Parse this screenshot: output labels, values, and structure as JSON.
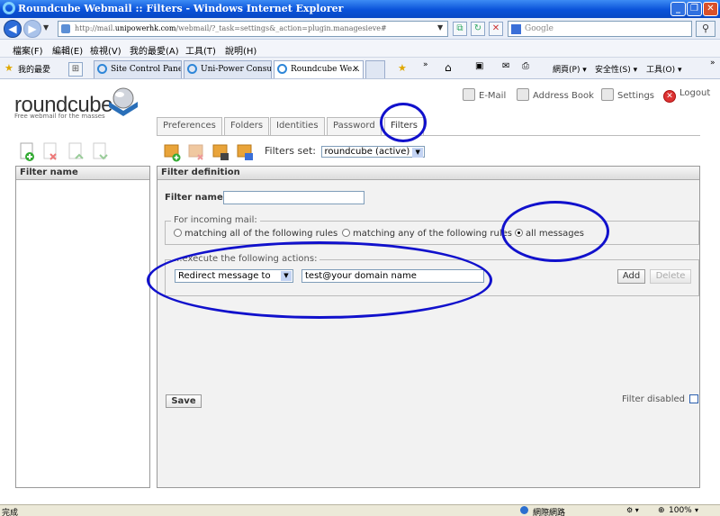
{
  "window": {
    "title": "Roundcube Webmail :: Filters - Windows Internet Explorer"
  },
  "addressbar": {
    "url_prefix": "http://mail.",
    "url_host": "unipowerhk.com",
    "url_rest": "/webmail/?_task=settings&_action=plugin.managesieve#",
    "search_placeholder": "Google"
  },
  "menubar": [
    "檔案(F)",
    "編輯(E)",
    "檢視(V)",
    "我的最愛(A)",
    "工具(T)",
    "說明(H)"
  ],
  "favorites": {
    "label": "我的最愛",
    "tabs": [
      "Site Control Panel",
      "Uni-Power Consult...",
      "Roundcube We..."
    ],
    "commands": [
      "網頁(P) ▾",
      "安全性(S) ▾",
      "工具(O) ▾"
    ]
  },
  "app": {
    "logo": "roundcube",
    "logo_sub": "Free webmail for the masses",
    "topnav": [
      "E-Mail",
      "Address Book",
      "Settings",
      "Logout"
    ],
    "tabs": [
      "Preferences",
      "Folders",
      "Identities",
      "Password",
      "Filters"
    ],
    "filters_set_label": "Filters set:",
    "filters_set_value": "roundcube (active)",
    "filter_list_header": "Filter name",
    "definition_header": "Filter definition",
    "filter_name_label": "Filter name:",
    "filter_name_value": "",
    "incoming_legend": "For incoming mail:",
    "radio_all_rules": "matching all of the following rules",
    "radio_any_rules": "matching any of the following rules",
    "radio_all_messages": "all messages",
    "actions_legend": "...execute the following actions:",
    "action_select": "Redirect message to",
    "action_value": "test@your domain name",
    "add_button": "Add",
    "delete_button": "Delete",
    "save_button": "Save",
    "filter_disabled_label": "Filter disabled"
  },
  "statusbar": {
    "left": "完成",
    "zone": "網際網路",
    "zoom": "100%"
  },
  "colors": {
    "annotation": "#1111cc",
    "titlebar": "#0a52d9"
  }
}
